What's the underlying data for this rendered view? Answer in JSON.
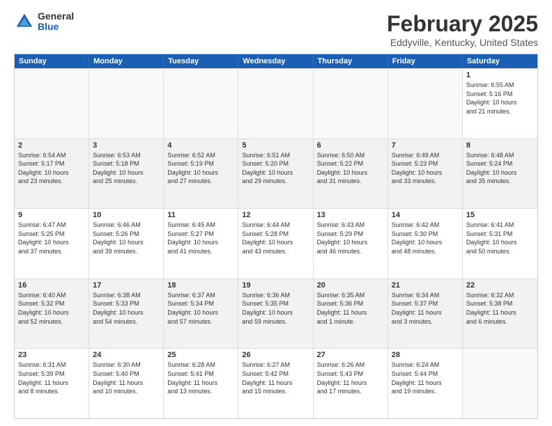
{
  "logo": {
    "general": "General",
    "blue": "Blue"
  },
  "title": "February 2025",
  "subtitle": "Eddyville, Kentucky, United States",
  "weekdays": [
    "Sunday",
    "Monday",
    "Tuesday",
    "Wednesday",
    "Thursday",
    "Friday",
    "Saturday"
  ],
  "weeks": [
    [
      {
        "day": "",
        "info": "",
        "empty": true
      },
      {
        "day": "",
        "info": "",
        "empty": true
      },
      {
        "day": "",
        "info": "",
        "empty": true
      },
      {
        "day": "",
        "info": "",
        "empty": true
      },
      {
        "day": "",
        "info": "",
        "empty": true
      },
      {
        "day": "",
        "info": "",
        "empty": true
      },
      {
        "day": "1",
        "info": "Sunrise: 6:55 AM\nSunset: 5:16 PM\nDaylight: 10 hours\nand 21 minutes.",
        "empty": false
      }
    ],
    [
      {
        "day": "2",
        "info": "Sunrise: 6:54 AM\nSunset: 5:17 PM\nDaylight: 10 hours\nand 23 minutes.",
        "empty": false
      },
      {
        "day": "3",
        "info": "Sunrise: 6:53 AM\nSunset: 5:18 PM\nDaylight: 10 hours\nand 25 minutes.",
        "empty": false
      },
      {
        "day": "4",
        "info": "Sunrise: 6:52 AM\nSunset: 5:19 PM\nDaylight: 10 hours\nand 27 minutes.",
        "empty": false
      },
      {
        "day": "5",
        "info": "Sunrise: 6:51 AM\nSunset: 5:20 PM\nDaylight: 10 hours\nand 29 minutes.",
        "empty": false
      },
      {
        "day": "6",
        "info": "Sunrise: 6:50 AM\nSunset: 5:22 PM\nDaylight: 10 hours\nand 31 minutes.",
        "empty": false
      },
      {
        "day": "7",
        "info": "Sunrise: 6:49 AM\nSunset: 5:23 PM\nDaylight: 10 hours\nand 33 minutes.",
        "empty": false
      },
      {
        "day": "8",
        "info": "Sunrise: 6:48 AM\nSunset: 5:24 PM\nDaylight: 10 hours\nand 35 minutes.",
        "empty": false
      }
    ],
    [
      {
        "day": "9",
        "info": "Sunrise: 6:47 AM\nSunset: 5:25 PM\nDaylight: 10 hours\nand 37 minutes.",
        "empty": false
      },
      {
        "day": "10",
        "info": "Sunrise: 6:46 AM\nSunset: 5:26 PM\nDaylight: 10 hours\nand 39 minutes.",
        "empty": false
      },
      {
        "day": "11",
        "info": "Sunrise: 6:45 AM\nSunset: 5:27 PM\nDaylight: 10 hours\nand 41 minutes.",
        "empty": false
      },
      {
        "day": "12",
        "info": "Sunrise: 6:44 AM\nSunset: 5:28 PM\nDaylight: 10 hours\nand 43 minutes.",
        "empty": false
      },
      {
        "day": "13",
        "info": "Sunrise: 6:43 AM\nSunset: 5:29 PM\nDaylight: 10 hours\nand 46 minutes.",
        "empty": false
      },
      {
        "day": "14",
        "info": "Sunrise: 6:42 AM\nSunset: 5:30 PM\nDaylight: 10 hours\nand 48 minutes.",
        "empty": false
      },
      {
        "day": "15",
        "info": "Sunrise: 6:41 AM\nSunset: 5:31 PM\nDaylight: 10 hours\nand 50 minutes.",
        "empty": false
      }
    ],
    [
      {
        "day": "16",
        "info": "Sunrise: 6:40 AM\nSunset: 5:32 PM\nDaylight: 10 hours\nand 52 minutes.",
        "empty": false
      },
      {
        "day": "17",
        "info": "Sunrise: 6:38 AM\nSunset: 5:33 PM\nDaylight: 10 hours\nand 54 minutes.",
        "empty": false
      },
      {
        "day": "18",
        "info": "Sunrise: 6:37 AM\nSunset: 5:34 PM\nDaylight: 10 hours\nand 57 minutes.",
        "empty": false
      },
      {
        "day": "19",
        "info": "Sunrise: 6:36 AM\nSunset: 5:35 PM\nDaylight: 10 hours\nand 59 minutes.",
        "empty": false
      },
      {
        "day": "20",
        "info": "Sunrise: 6:35 AM\nSunset: 5:36 PM\nDaylight: 11 hours\nand 1 minute.",
        "empty": false
      },
      {
        "day": "21",
        "info": "Sunrise: 6:34 AM\nSunset: 5:37 PM\nDaylight: 11 hours\nand 3 minutes.",
        "empty": false
      },
      {
        "day": "22",
        "info": "Sunrise: 6:32 AM\nSunset: 5:38 PM\nDaylight: 11 hours\nand 6 minutes.",
        "empty": false
      }
    ],
    [
      {
        "day": "23",
        "info": "Sunrise: 6:31 AM\nSunset: 5:39 PM\nDaylight: 11 hours\nand 8 minutes.",
        "empty": false
      },
      {
        "day": "24",
        "info": "Sunrise: 6:30 AM\nSunset: 5:40 PM\nDaylight: 11 hours\nand 10 minutes.",
        "empty": false
      },
      {
        "day": "25",
        "info": "Sunrise: 6:28 AM\nSunset: 5:41 PM\nDaylight: 11 hours\nand 13 minutes.",
        "empty": false
      },
      {
        "day": "26",
        "info": "Sunrise: 6:27 AM\nSunset: 5:42 PM\nDaylight: 11 hours\nand 15 minutes.",
        "empty": false
      },
      {
        "day": "27",
        "info": "Sunrise: 6:26 AM\nSunset: 5:43 PM\nDaylight: 11 hours\nand 17 minutes.",
        "empty": false
      },
      {
        "day": "28",
        "info": "Sunrise: 6:24 AM\nSunset: 5:44 PM\nDaylight: 11 hours\nand 19 minutes.",
        "empty": false
      },
      {
        "day": "",
        "info": "",
        "empty": true
      }
    ]
  ]
}
